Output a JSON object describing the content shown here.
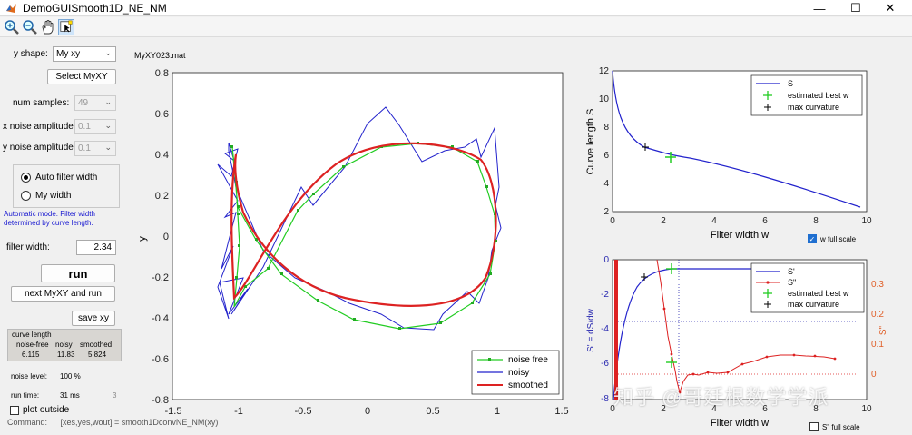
{
  "window": {
    "title": "DemoGUISmooth1D_NE_NM",
    "min_label": "—",
    "max_label": "☐",
    "close_label": "✕"
  },
  "toolbar": {
    "tools": [
      "zoom-in",
      "zoom-out",
      "pan",
      "data-cursor"
    ]
  },
  "controls": {
    "y_shape_label": "y shape:",
    "y_shape_value": "My xy",
    "select_myxy_label": "Select MyXY",
    "num_samples_label": "num samples:",
    "num_samples_value": "49",
    "x_noise_label": "x noise amplitude:",
    "x_noise_value": "0.1",
    "y_noise_label": "y noise amplitude:",
    "y_noise_value": "0.1",
    "auto_filter_label": "Auto filter width",
    "my_width_label": "My width",
    "info_text": "Automatic mode.  Filter width determined by curve length.",
    "filter_width_label": "filter width:",
    "filter_width_value": "2.34",
    "run_label": "run",
    "next_label": "next MyXY and run",
    "save_label": "save xy",
    "curve_length_title": "curve length",
    "curve_length_headers": [
      "noise-free",
      "noisy",
      "smoothed"
    ],
    "curve_length_values": [
      "6.115",
      "11.83",
      "5.824"
    ],
    "noise_level_label": "noise level:",
    "noise_level_value": "100 %",
    "run_time_label": "run time:",
    "run_time_value": "31 ms",
    "run_time_extra": "3",
    "plot_outside_label": "plot outside",
    "command_label": "Command:",
    "command_text": "[xes,yes,wout] = smooth1DconvNE_NM(xy)"
  },
  "main_plot": {
    "file_label": "MyXY023.mat",
    "ylabel": "y",
    "x_ticks": [
      "-1.5",
      "-1",
      "-0.5",
      "0",
      "0.5",
      "1",
      "1.5"
    ],
    "y_ticks": [
      "0.8",
      "0.6",
      "0.4",
      "0.2",
      "0",
      "-0.2",
      "-0.4",
      "-0.6",
      "-0.8"
    ],
    "legend": [
      "noise free",
      "noisy",
      "smoothed"
    ],
    "colors": {
      "noise_free": "#22cc22",
      "noisy": "#2222cc",
      "smoothed": "#dd2222"
    }
  },
  "top_right_plot": {
    "ylabel": "Curve length S",
    "xlabel": "Filter width w",
    "x_ticks": [
      "0",
      "2",
      "4",
      "6",
      "8",
      "10"
    ],
    "y_ticks": [
      "12",
      "10",
      "8",
      "6",
      "4",
      "2"
    ],
    "legend": [
      "S",
      "estimated best w",
      "max curvature"
    ],
    "full_scale_label": "w full scale"
  },
  "bottom_right_plot": {
    "ylabel_left": "S' = dS/dw",
    "ylabel_right": "S\"",
    "xlabel": "Filter width w",
    "x_ticks": [
      "0",
      "2",
      "4",
      "6",
      "8",
      "10"
    ],
    "y_ticks_left": [
      "0",
      "-2",
      "-4",
      "-6",
      "-8"
    ],
    "y_ticks_right": [
      "0.3",
      "0.2",
      "0.1",
      "0"
    ],
    "legend": [
      "S'",
      "S\"",
      "estimated best w",
      "max curvature"
    ],
    "full_scale_label": "S\" full scale"
  },
  "watermark": "知乎 @哥廷根数学学派"
}
